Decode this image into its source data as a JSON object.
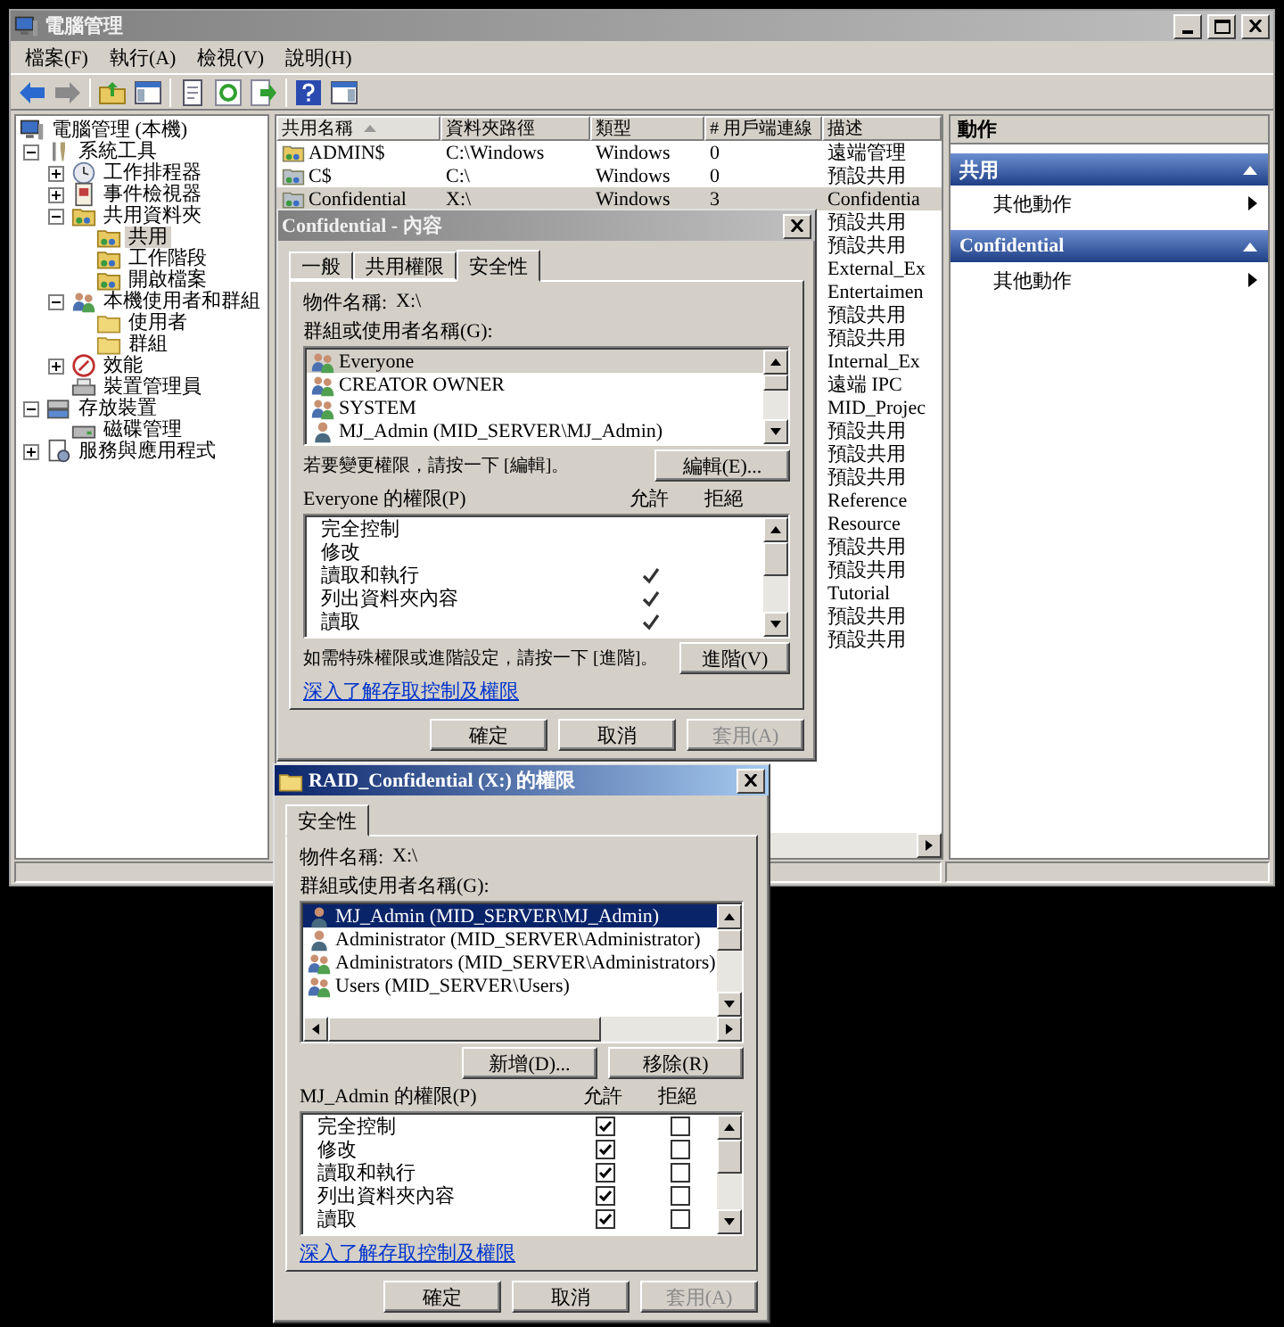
{
  "window": {
    "title": "電腦管理"
  },
  "menu": [
    "檔案(F)",
    "執行(A)",
    "檢視(V)",
    "說明(H)"
  ],
  "tree": [
    {
      "label": "電腦管理 (本機)",
      "selected": false,
      "children": [
        {
          "label": "系統工具",
          "expanded": true,
          "selected": false,
          "children": [
            {
              "label": "工作排程器",
              "expanded": false,
              "selected": false
            },
            {
              "label": "事件檢視器",
              "expanded": false,
              "selected": false
            },
            {
              "label": "共用資料夾",
              "expanded": true,
              "selected": false,
              "children": [
                {
                  "label": "共用",
                  "selected": true
                },
                {
                  "label": "工作階段",
                  "selected": false
                },
                {
                  "label": "開啟檔案",
                  "selected": false
                }
              ]
            },
            {
              "label": "本機使用者和群組",
              "expanded": true,
              "selected": false,
              "children": [
                {
                  "label": "使用者",
                  "selected": false
                },
                {
                  "label": "群組",
                  "selected": false
                }
              ]
            },
            {
              "label": "效能",
              "expanded": false,
              "selected": false
            },
            {
              "label": "裝置管理員",
              "selected": false
            }
          ]
        },
        {
          "label": "存放裝置",
          "expanded": true,
          "selected": false,
          "children": [
            {
              "label": "磁碟管理",
              "selected": false
            }
          ]
        },
        {
          "label": "服務與應用程式",
          "expanded": false,
          "selected": false
        }
      ]
    }
  ],
  "share_list": {
    "columns": [
      {
        "label": "共用名稱",
        "sorted": true
      },
      {
        "label": "資料夾路徑",
        "sorted": false
      },
      {
        "label": "類型",
        "sorted": false
      },
      {
        "label": "# 用戶端連線",
        "sorted": false
      },
      {
        "label": "描述",
        "sorted": false
      }
    ],
    "rows": [
      {
        "share_name": "ADMIN$",
        "folder_path": "C:\\Windows",
        "type": "Windows",
        "client_connections": "0",
        "description": "遠端管理",
        "selected": false
      },
      {
        "share_name": "C$",
        "folder_path": "C:\\",
        "type": "Windows",
        "client_connections": "0",
        "description": "預設共用",
        "selected": false
      },
      {
        "share_name": "Confidential",
        "folder_path": "X:\\",
        "type": "Windows",
        "client_connections": "3",
        "description": "Confidentia",
        "selected": true
      },
      {
        "description": "預設共用",
        "selected": false
      },
      {
        "description": "預設共用",
        "selected": false
      },
      {
        "description": "External_Ex",
        "selected": false
      },
      {
        "description": "Entertaimen",
        "selected": false
      },
      {
        "description": "預設共用",
        "selected": false
      },
      {
        "description": "預設共用",
        "selected": false
      },
      {
        "description": "Internal_Ex",
        "selected": false
      },
      {
        "description": "遠端 IPC",
        "selected": false
      },
      {
        "description": "MID_Projec",
        "selected": false
      },
      {
        "description": "預設共用",
        "selected": false
      },
      {
        "description": "預設共用",
        "selected": false
      },
      {
        "description": "預設共用",
        "selected": false
      },
      {
        "description": "Reference",
        "selected": false
      },
      {
        "description": "Resource",
        "selected": false
      },
      {
        "description": "預設共用",
        "selected": false
      },
      {
        "description": "預設共用",
        "selected": false
      },
      {
        "description": "Tutorial",
        "selected": false
      },
      {
        "description": "預設共用",
        "selected": false
      },
      {
        "description": "預設共用",
        "selected": false
      }
    ]
  },
  "actions": {
    "title": "動作",
    "sections": [
      {
        "title": "共用",
        "items": [
          "其他動作"
        ]
      },
      {
        "title": "Confidential",
        "items": [
          "其他動作"
        ]
      }
    ]
  },
  "properties_dialog": {
    "title": "Confidential - 內容",
    "active": false,
    "tabs": [
      {
        "label": "一般",
        "selected": false
      },
      {
        "label": "共用權限",
        "selected": false
      },
      {
        "label": "安全性",
        "selected": true
      }
    ],
    "object_label": "物件名稱:",
    "object_value": "X:\\",
    "group_label": "群組或使用者名稱(G):",
    "horizontal_scrollbar": false,
    "users": [
      {
        "name": "Everyone",
        "kind": "group",
        "selected": true
      },
      {
        "name": "CREATOR OWNER",
        "kind": "group",
        "selected": false
      },
      {
        "name": "SYSTEM",
        "kind": "group",
        "selected": false
      },
      {
        "name": "MJ_Admin (MID_SERVER\\MJ_Admin)",
        "kind": "user",
        "selected": false
      }
    ],
    "hint": "若要變更權限，請按一下 [編輯]。",
    "user_buttons": [
      {
        "label": "編輯(E)...",
        "disabled": false
      }
    ],
    "permissions_label": "Everyone 的權限(P)",
    "allow_label": "允許",
    "deny_label": "拒絕",
    "checkboxes": false,
    "permissions": [
      {
        "name": "完全控制",
        "allow": false,
        "deny": false
      },
      {
        "name": "修改",
        "allow": false,
        "deny": false
      },
      {
        "name": "讀取和執行",
        "allow": true,
        "deny": false
      },
      {
        "name": "列出資料夾內容",
        "allow": true,
        "deny": false
      },
      {
        "name": "讀取",
        "allow": true,
        "deny": false
      }
    ],
    "advanced_hint": "如需特殊權限或進階設定，請按一下 [進階]。",
    "advanced_button": "進階(V)",
    "link": "深入了解存取控制及權限",
    "buttons": [
      {
        "label": "確定",
        "disabled": false
      },
      {
        "label": "取消",
        "disabled": false
      },
      {
        "label": "套用(A)",
        "disabled": true
      }
    ]
  },
  "permissions_dialog": {
    "title": "RAID_Confidential (X:) 的權限",
    "active": true,
    "tabs": [
      {
        "label": "安全性",
        "selected": true
      }
    ],
    "object_label": "物件名稱:",
    "object_value": "X:\\",
    "group_label": "群組或使用者名稱(G):",
    "horizontal_scrollbar": true,
    "users": [
      {
        "name": "MJ_Admin (MID_SERVER\\MJ_Admin)",
        "kind": "user",
        "selected": true
      },
      {
        "name": "Administrator (MID_SERVER\\Administrator)",
        "kind": "user",
        "selected": false
      },
      {
        "name": "Administrators (MID_SERVER\\Administrators)",
        "kind": "group",
        "selected": false
      },
      {
        "name": "Users (MID_SERVER\\Users)",
        "kind": "group",
        "selected": false
      }
    ],
    "user_buttons": [
      {
        "label": "新增(D)...",
        "disabled": false
      },
      {
        "label": "移除(R)",
        "disabled": false
      }
    ],
    "permissions_label": "MJ_Admin 的權限(P)",
    "allow_label": "允許",
    "deny_label": "拒絕",
    "checkboxes": true,
    "permissions": [
      {
        "name": "完全控制",
        "allow": true,
        "deny": false
      },
      {
        "name": "修改",
        "allow": true,
        "deny": false
      },
      {
        "name": "讀取和執行",
        "allow": true,
        "deny": false
      },
      {
        "name": "列出資料夾內容",
        "allow": true,
        "deny": false
      },
      {
        "name": "讀取",
        "allow": true,
        "deny": false
      }
    ],
    "link": "深入了解存取控制及權限",
    "buttons": [
      {
        "label": "確定",
        "disabled": false
      },
      {
        "label": "取消",
        "disabled": false
      },
      {
        "label": "套用(A)",
        "disabled": true
      }
    ]
  }
}
